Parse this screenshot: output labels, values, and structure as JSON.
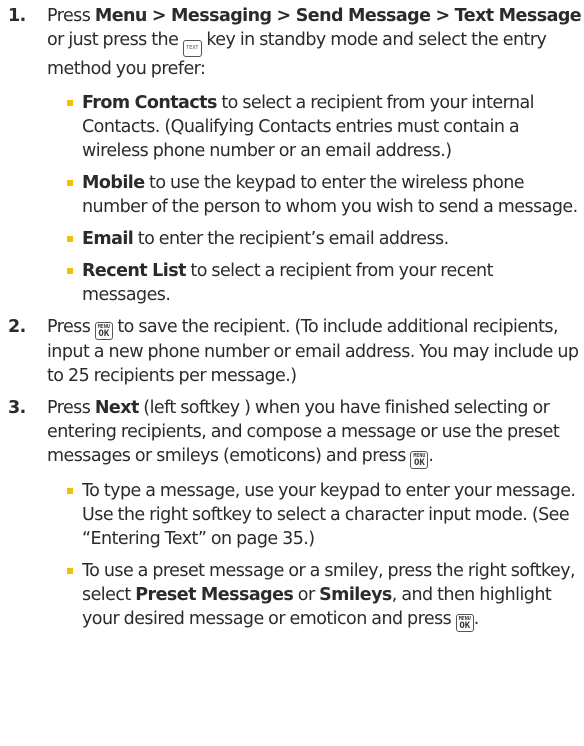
{
  "steps": [
    {
      "number": "1.",
      "path": "Menu > Messaging > Send Message > Text Message",
      "text_a": "Press ",
      "text_b": " or just press the ",
      "text_c": " key in standby mode and select the entry method you prefer:",
      "key_icon": "text-key-icon",
      "key_label": "TEXT",
      "bullets": [
        {
          "bold": "From Contacts",
          "text": " to select a recipient from your internal Contacts. (Qualifying Contacts entries must contain a wireless phone number or an email address.)"
        },
        {
          "bold": "Mobile",
          "text": " to use the keypad to enter the wireless phone number of the person to whom you wish to send a message."
        },
        {
          "bold": "Email",
          "text": " to enter the recipient’s email address."
        },
        {
          "bold": "Recent List",
          "text": " to select a recipient from your recent messages."
        }
      ]
    },
    {
      "number": "2.",
      "text_a": "Press ",
      "text_b": " to save the recipient. (To include additional recipients, input a new phone number or email address. You may include up to 25 recipients per message.)",
      "key_icon": "menu-ok-key-icon",
      "key_top": "MENU",
      "key_bottom": "OK"
    },
    {
      "number": "3.",
      "text_a": "Press ",
      "bold": "Next",
      "text_b": " (left softkey ) when you have finished selecting or entering recipients, and compose a message or use the preset messages or smileys (emoticons) and press ",
      "text_c": ".",
      "key_icon": "menu-ok-key-icon",
      "key_top": "MENU",
      "key_bottom": "OK",
      "bullets": [
        {
          "text": "To type a message, use your keypad to enter your message. Use the right softkey to select a character input mode. (See “Entering Text” on page 35.)"
        },
        {
          "text_a": "To use a preset  message or a smiley, press the right softkey, select ",
          "bold_a": "Preset Messages",
          "text_b": " or ",
          "bold_b": "Smileys",
          "text_c": ", and then highlight your desired message or emoticon and press ",
          "text_d": "."
        }
      ]
    }
  ],
  "colors": {
    "text": "#2b2b2b",
    "bullet": "#f2c200"
  }
}
